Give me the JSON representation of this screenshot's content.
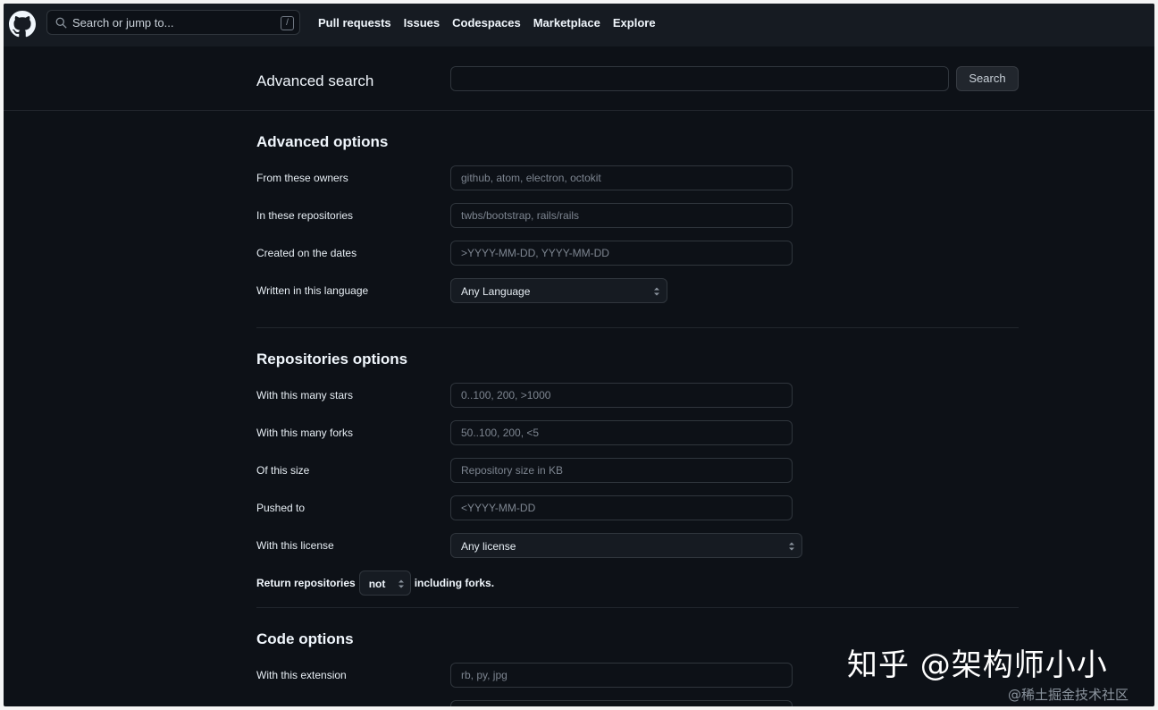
{
  "header": {
    "search_placeholder": "Search or jump to...",
    "slash_key": "/",
    "nav": [
      "Pull requests",
      "Issues",
      "Codespaces",
      "Marketplace",
      "Explore"
    ]
  },
  "advanced_search": {
    "title": "Advanced search",
    "query_value": "",
    "button": "Search"
  },
  "advanced_options": {
    "title": "Advanced options",
    "owners": {
      "label": "From these owners",
      "placeholder": "github, atom, electron, octokit"
    },
    "repos": {
      "label": "In these repositories",
      "placeholder": "twbs/bootstrap, rails/rails"
    },
    "dates": {
      "label": "Created on the dates",
      "placeholder": ">YYYY-MM-DD, YYYY-MM-DD"
    },
    "language": {
      "label": "Written in this language",
      "selected": "Any Language"
    }
  },
  "repositories_options": {
    "title": "Repositories options",
    "stars": {
      "label": "With this many stars",
      "placeholder": "0..100, 200, >1000"
    },
    "forks": {
      "label": "With this many forks",
      "placeholder": "50..100, 200, <5"
    },
    "size": {
      "label": "Of this size",
      "placeholder": "Repository size in KB"
    },
    "pushed": {
      "label": "Pushed to",
      "placeholder": "<YYYY-MM-DD"
    },
    "license": {
      "label": "With this license",
      "selected": "Any license"
    },
    "forks_row": {
      "prefix": "Return repositories",
      "selected": "not",
      "suffix": "including forks."
    }
  },
  "code_options": {
    "title": "Code options",
    "extension": {
      "label": "With this extension",
      "placeholder": "rb, py, jpg"
    }
  },
  "watermark": {
    "main": "知乎 @架构师小小",
    "sub": "@稀土掘金技术社区"
  }
}
